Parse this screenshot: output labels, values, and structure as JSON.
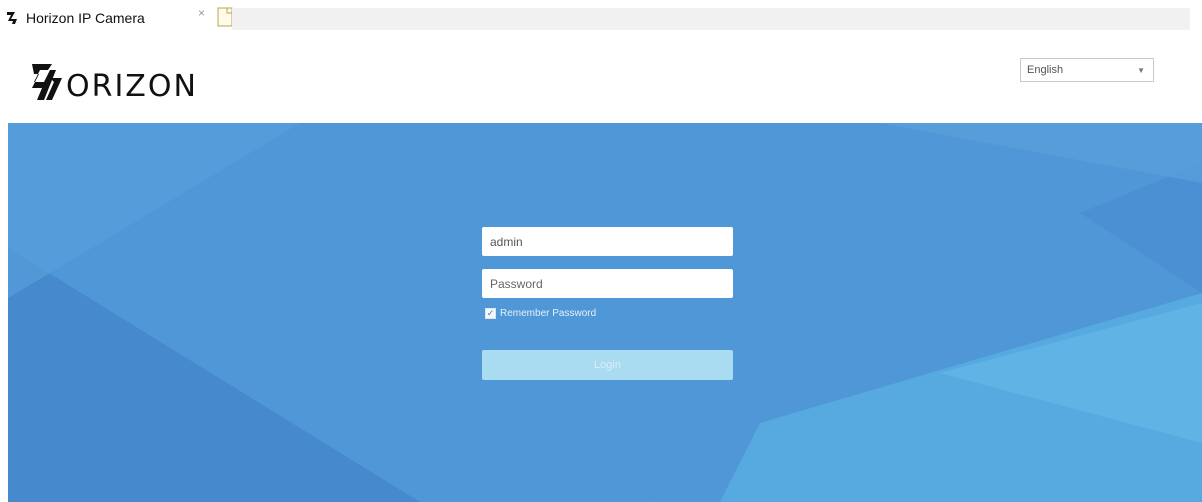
{
  "tab": {
    "title": "Horizon IP Camera",
    "close": "×"
  },
  "header": {
    "logo_text": "ORIZON",
    "language": {
      "selected": "English",
      "arrow": "▼"
    }
  },
  "login": {
    "username_value": "admin",
    "password_placeholder": "Password",
    "remember_label": "Remember Password",
    "remember_checked": true,
    "check_glyph": "✓",
    "button_label": "Login"
  },
  "colors": {
    "hero_blue": "#4f97d6",
    "button_disabled": "#a9dbf1"
  }
}
